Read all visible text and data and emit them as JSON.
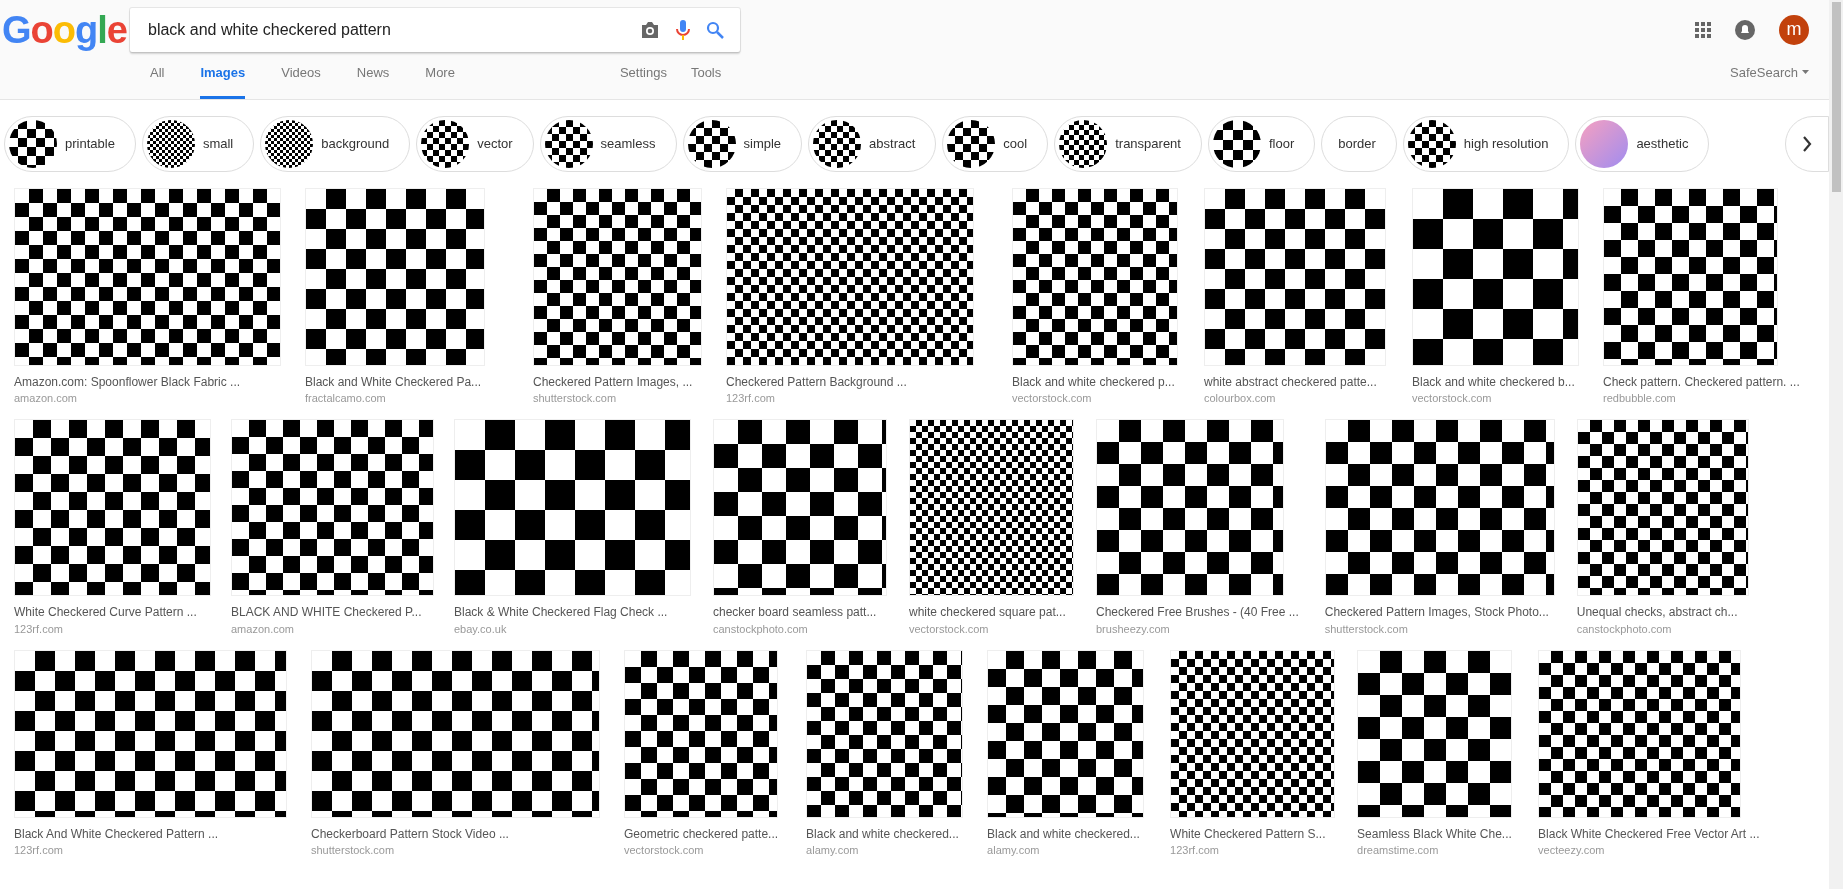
{
  "logo": "Google",
  "search": {
    "query": "black and white checkered pattern"
  },
  "account": {
    "initial": "m"
  },
  "tabs": [
    {
      "label": "All",
      "selected": false
    },
    {
      "label": "Images",
      "selected": true
    },
    {
      "label": "Videos",
      "selected": false
    },
    {
      "label": "News",
      "selected": false
    },
    {
      "label": "More",
      "selected": false
    }
  ],
  "tools": [
    "Settings",
    "Tools"
  ],
  "safesearch": "SafeSearch",
  "chips": [
    {
      "label": "printable",
      "kind": "checker"
    },
    {
      "label": "small",
      "kind": "checker"
    },
    {
      "label": "background",
      "kind": "checker"
    },
    {
      "label": "vector",
      "kind": "checker"
    },
    {
      "label": "seamless",
      "kind": "checker"
    },
    {
      "label": "simple",
      "kind": "checker"
    },
    {
      "label": "abstract",
      "kind": "checker"
    },
    {
      "label": "cool",
      "kind": "checker"
    },
    {
      "label": "transparent",
      "kind": "checker"
    },
    {
      "label": "floor",
      "kind": "checker"
    },
    {
      "label": "border",
      "kind": "text"
    },
    {
      "label": "high resolution",
      "kind": "checker"
    },
    {
      "label": "aesthetic",
      "kind": "gradient"
    }
  ],
  "results": [
    [
      {
        "title": "Amazon.com: Spoonflower Black Fabric ...",
        "source": "amazon.com"
      },
      {
        "title": "Black and White Checkered Pa...",
        "source": "fractalcamo.com"
      },
      {
        "title": "Checkered Pattern Images, ...",
        "source": "shutterstock.com"
      },
      {
        "title": "Checkered Pattern Background ...",
        "source": "123rf.com"
      },
      {
        "title": "Black and white checkered p...",
        "source": "vectorstock.com"
      },
      {
        "title": "white abstract checkered patte...",
        "source": "colourbox.com"
      },
      {
        "title": "Black and white checkered b...",
        "source": "vectorstock.com"
      },
      {
        "title": "Check pattern. Checkered pattern. ...",
        "source": "redbubble.com"
      }
    ],
    [
      {
        "title": "White Checkered Curve Pattern ...",
        "source": "123rf.com"
      },
      {
        "title": "BLACK AND WHITE Checkered P...",
        "source": "amazon.com"
      },
      {
        "title": "Black & White Checkered Flag Check ...",
        "source": "ebay.co.uk"
      },
      {
        "title": "checker board seamless patt...",
        "source": "canstockphoto.com"
      },
      {
        "title": "white checkered square pat...",
        "source": "vectorstock.com"
      },
      {
        "title": "Checkered Free Brushes - (40 Free ...",
        "source": "brusheezy.com"
      },
      {
        "title": "Checkered Pattern Images, Stock Photo...",
        "source": "shutterstock.com"
      },
      {
        "title": "Unequal checks, abstract ch...",
        "source": "canstockphoto.com"
      }
    ],
    [
      {
        "title": "Black And White Checkered Pattern ...",
        "source": "123rf.com"
      },
      {
        "title": "Checkerboard Pattern Stock Video ...",
        "source": "shutterstock.com"
      },
      {
        "title": "Geometric checkered patte...",
        "source": "vectorstock.com"
      },
      {
        "title": "Black and white checkered...",
        "source": "alamy.com"
      },
      {
        "title": "Black and white checkered...",
        "source": "alamy.com"
      },
      {
        "title": "White Checkered Pattern S...",
        "source": "123rf.com"
      },
      {
        "title": "Seamless Black White Che...",
        "source": "dreamstime.com"
      },
      {
        "title": "Black White Checkered Free Vector Art ...",
        "source": "vecteezy.com"
      }
    ]
  ]
}
